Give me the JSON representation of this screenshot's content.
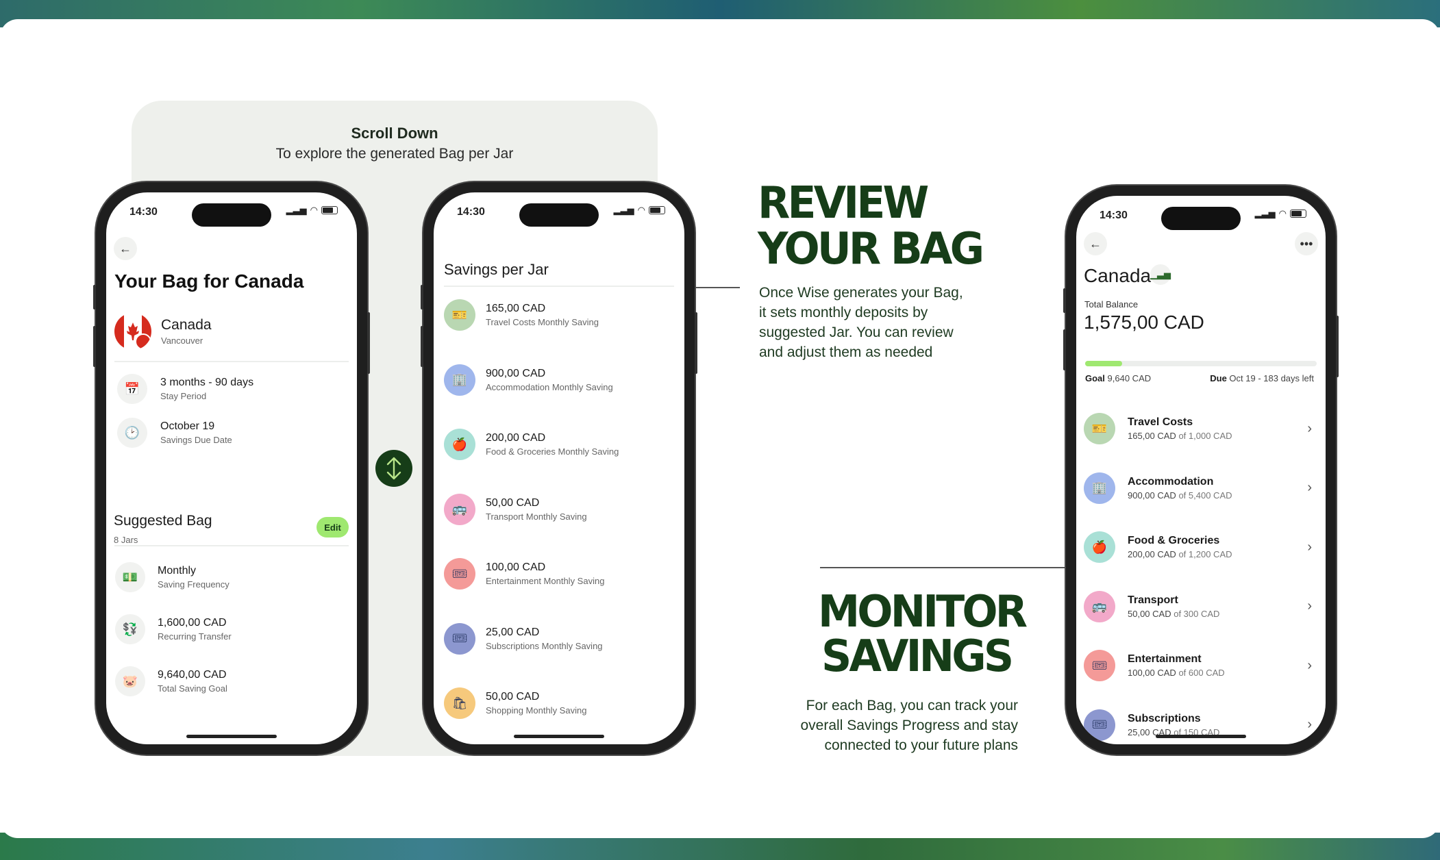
{
  "scroll_hint": {
    "title": "Scroll Down",
    "subtitle": "To explore the generated Bag per Jar"
  },
  "status_time": "14:30",
  "phone1": {
    "title": "Your Bag for Canada",
    "country": "Canada",
    "city": "Vancouver",
    "stay": {
      "label": "3 months - 90 days",
      "sub": "Stay Period"
    },
    "due": {
      "label": "October 19",
      "sub": "Savings Due Date"
    },
    "suggested": {
      "title": "Suggested Bag",
      "count": "8 Jars",
      "edit": "Edit"
    },
    "items": [
      {
        "label": "Monthly",
        "sub": "Saving Frequency",
        "icon": "cash-icon"
      },
      {
        "label": "1,600,00 CAD",
        "sub": "Recurring Transfer",
        "icon": "transfer-icon"
      },
      {
        "label": "9,640,00 CAD",
        "sub": "Total Saving Goal",
        "icon": "piggy-bank-icon"
      }
    ]
  },
  "phone2": {
    "title": "Savings per Jar",
    "jars": [
      {
        "amount": "165,00 CAD",
        "sub": "Travel Costs Monthly Saving",
        "color": "#b9d7b2",
        "icon": "ticket-icon",
        "glyph": "🎫"
      },
      {
        "amount": "900,00 CAD",
        "sub": "Accommodation Monthly Saving",
        "color": "#9fb6ec",
        "icon": "building-icon",
        "glyph": "🏢"
      },
      {
        "amount": "200,00 CAD",
        "sub": "Food & Groceries Monthly Saving",
        "color": "#a9e0d6",
        "icon": "apple-icon",
        "glyph": "🍎"
      },
      {
        "amount": "50,00 CAD",
        "sub": "Transport Monthly Saving",
        "color": "#f2a9c9",
        "icon": "bus-icon",
        "glyph": "🚌"
      },
      {
        "amount": "100,00 CAD",
        "sub": "Entertainment Monthly Saving",
        "color": "#f49a98",
        "icon": "ticket-stub-icon",
        "glyph": "🎟"
      },
      {
        "amount": "25,00 CAD",
        "sub": "Subscriptions Monthly Saving",
        "color": "#8c97cf",
        "icon": "subscription-icon",
        "glyph": "🎟"
      },
      {
        "amount": "50,00 CAD",
        "sub": "Shopping Monthly Saving",
        "color": "#f6c97c",
        "icon": "shopping-bag-icon",
        "glyph": "🛍"
      }
    ]
  },
  "review": {
    "heading_line1": "REVIEW",
    "heading_line2": "YOUR BAG",
    "body": "Once Wise generates your Bag, it sets monthly deposits by suggested Jar. You can review and adjust them as needed"
  },
  "monitor": {
    "heading_line1": "MONITOR",
    "heading_line2": "SAVINGS",
    "body": "For each Bag, you can track your overall Savings Progress and stay connected to your future plans"
  },
  "phone3": {
    "title": "Canada",
    "balance_label": "Total Balance",
    "balance": "1,575,00 CAD",
    "progress": 0.16,
    "goal_label": "Goal",
    "goal_value": "9,640 CAD",
    "due_label": "Due",
    "due_value": "Oct 19 - 183 days left",
    "jars": [
      {
        "name": "Travel Costs",
        "saved": "165,00 CAD",
        "of": "of 1,000 CAD",
        "color": "#b9d7b2",
        "glyph": "🎫"
      },
      {
        "name": "Accommodation",
        "saved": "900,00 CAD",
        "of": "of 5,400 CAD",
        "color": "#9fb6ec",
        "glyph": "🏢"
      },
      {
        "name": "Food & Groceries",
        "saved": "200,00 CAD",
        "of": "of 1,200 CAD",
        "color": "#a9e0d6",
        "glyph": "🍎"
      },
      {
        "name": "Transport",
        "saved": "50,00 CAD",
        "of": "of 300 CAD",
        "color": "#f2a9c9",
        "glyph": "🚌"
      },
      {
        "name": "Entertainment",
        "saved": "100,00 CAD",
        "of": "of 600 CAD",
        "color": "#f49a98",
        "glyph": "🎟"
      },
      {
        "name": "Subscriptions",
        "saved": "25,00 CAD",
        "of": "of 150 CAD",
        "color": "#8c97cf",
        "glyph": "🎟"
      }
    ]
  }
}
